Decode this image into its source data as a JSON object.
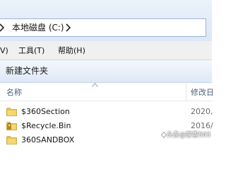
{
  "address": {
    "location": "本地磁盘 (C:)"
  },
  "menu": {
    "items": [
      {
        "label": "V)"
      },
      {
        "label": "工具(T)"
      },
      {
        "label": "帮助(H)"
      }
    ]
  },
  "toolbar": {
    "new_folder_label": "新建文件夹"
  },
  "columns": {
    "name": "名称",
    "date_modified": "修改日"
  },
  "files": [
    {
      "name": "$360Section",
      "date": "2020,",
      "icon": "folder-icon"
    },
    {
      "name": "$Recycle.Bin",
      "date": "2016/",
      "icon": "locked-folder-icon"
    },
    {
      "name": "360SANDBOX",
      "date": "",
      "icon": "folder-icon"
    }
  ],
  "watermark": {
    "text": "头条@家香503"
  },
  "colors": {
    "folder": "#e9c34f",
    "chrome": "#dbe7f5",
    "menu_bg": "#f0f0f0"
  }
}
